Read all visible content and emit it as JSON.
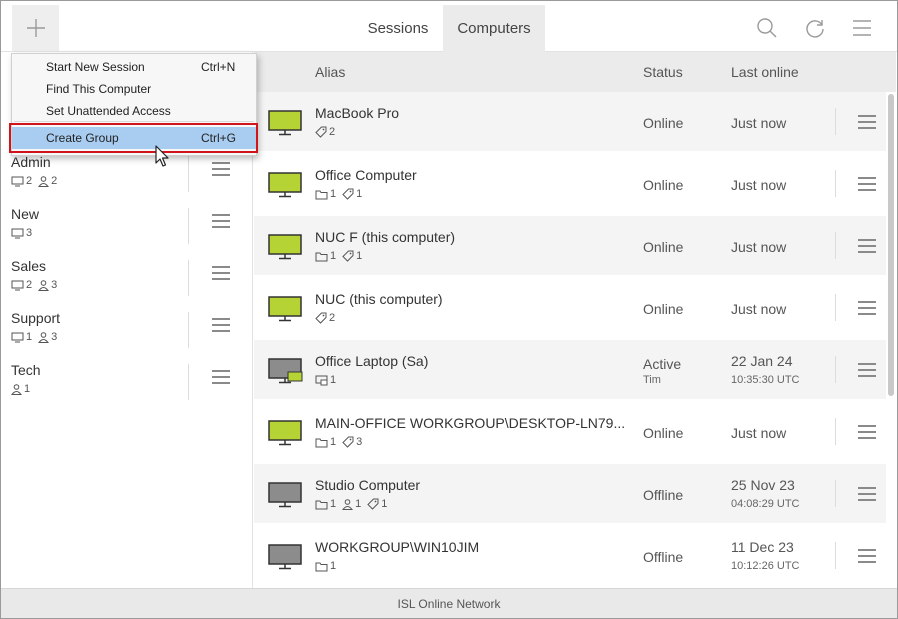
{
  "header": {
    "tabs": [
      {
        "label": "Sessions",
        "active": false
      },
      {
        "label": "Computers",
        "active": true
      }
    ],
    "icons": [
      "plus-icon",
      "search-icon",
      "refresh-icon",
      "menu-icon"
    ]
  },
  "menu": {
    "items": [
      {
        "label": "Start New Session",
        "shortcut": "Ctrl+N"
      },
      {
        "label": "Find This Computer",
        "shortcut": ""
      },
      {
        "label": "Set Unattended Access",
        "shortcut": ""
      },
      {
        "label": "Create Group",
        "shortcut": "Ctrl+G",
        "highlighted": true
      }
    ]
  },
  "groups": [
    {
      "name": "Admin",
      "computers": "2",
      "users": "2"
    },
    {
      "name": "New",
      "computers": "3"
    },
    {
      "name": "Sales",
      "computers": "2",
      "users": "3"
    },
    {
      "name": "Support",
      "computers": "1",
      "users": "3"
    },
    {
      "name": "Tech",
      "users": "1"
    }
  ],
  "columns": {
    "alias": "Alias",
    "status": "Status",
    "last_online": "Last online"
  },
  "computers": [
    {
      "alias": "MacBook Pro",
      "tags": "2",
      "status": "Online",
      "last": "Just now"
    },
    {
      "alias": "Office Computer",
      "groups": "1",
      "tags": "1",
      "status": "Online",
      "last": "Just now"
    },
    {
      "alias": "NUC F (this computer)",
      "groups": "1",
      "tags": "1",
      "status": "Online",
      "last": "Just now"
    },
    {
      "alias": "NUC (this computer)",
      "tags": "2",
      "status": "Online",
      "last": "Just now"
    },
    {
      "alias": "Office Laptop (Sa)",
      "sessions": "1",
      "status": "Active",
      "status_sub": "Tim",
      "last": "22 Jan 24",
      "time": "10:35:30 UTC"
    },
    {
      "alias": "MAIN-OFFICE WORKGROUP\\DESKTOP-LN79...",
      "groups": "1",
      "tags": "3",
      "status": "Online",
      "last": "Just now"
    },
    {
      "alias": "Studio Computer",
      "groups": "1",
      "users": "1",
      "tags": "1",
      "status": "Offline",
      "last": "25 Nov 23",
      "time": "04:08:29 UTC"
    },
    {
      "alias": "WORKGROUP\\WIN10JIM",
      "groups": "1",
      "status": "Offline",
      "last": "11 Dec 23",
      "time": "10:12:26 UTC"
    }
  ],
  "footer": {
    "label": "ISL Online Network"
  },
  "colors": {
    "online": "#b5d334",
    "offline": "#8c8c8c",
    "highlight": "#a9cdf1",
    "annotation": "#d0141c"
  }
}
